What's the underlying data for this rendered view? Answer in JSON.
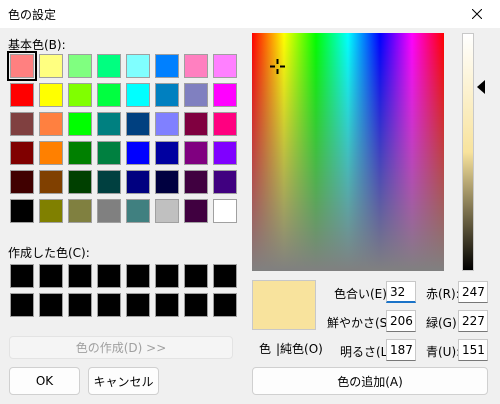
{
  "window": {
    "title": "色の設定"
  },
  "basic_colors": {
    "label": "基本色(B):",
    "swatches": [
      "#ff8080",
      "#ffff80",
      "#80ff80",
      "#00ff80",
      "#80ffff",
      "#0080ff",
      "#ff80c0",
      "#ff80ff",
      "#ff0000",
      "#ffff00",
      "#80ff00",
      "#00ff40",
      "#00ffff",
      "#0080c0",
      "#8080c0",
      "#ff00ff",
      "#804040",
      "#ff8040",
      "#00ff00",
      "#008080",
      "#004080",
      "#8080ff",
      "#800040",
      "#ff0080",
      "#800000",
      "#ff8000",
      "#008000",
      "#008040",
      "#0000ff",
      "#0000a0",
      "#800080",
      "#8000ff",
      "#400000",
      "#804000",
      "#004000",
      "#004040",
      "#000080",
      "#000040",
      "#400040",
      "#400080",
      "#000000",
      "#808000",
      "#808040",
      "#808080",
      "#408080",
      "#c0c0c0",
      "#400040",
      "#ffffff"
    ],
    "selected_index": 0
  },
  "custom_colors": {
    "label": "作成した色(C):",
    "swatches": [
      "#000000",
      "#000000",
      "#000000",
      "#000000",
      "#000000",
      "#000000",
      "#000000",
      "#000000",
      "#000000",
      "#000000",
      "#000000",
      "#000000",
      "#000000",
      "#000000",
      "#000000",
      "#000000"
    ]
  },
  "buttons": {
    "define_custom": "色の作成(D) >>",
    "ok": "OK",
    "cancel": "キャンセル",
    "add_custom": "色の追加(A)"
  },
  "preview": {
    "label_color": "色",
    "label_solid": "|純色(O)",
    "color": "#f8e39d"
  },
  "hsl": {
    "hue_label": "色合い(E):",
    "hue": "32",
    "sat_label": "鮮やかさ(S):",
    "sat": "206",
    "lum_label": "明るさ(L):",
    "lum": "187"
  },
  "rgb": {
    "red_label": "赤(R):",
    "red": "247",
    "green_label": "緑(G):",
    "green": "227",
    "blue_label": "青(U):",
    "blue": "151"
  }
}
